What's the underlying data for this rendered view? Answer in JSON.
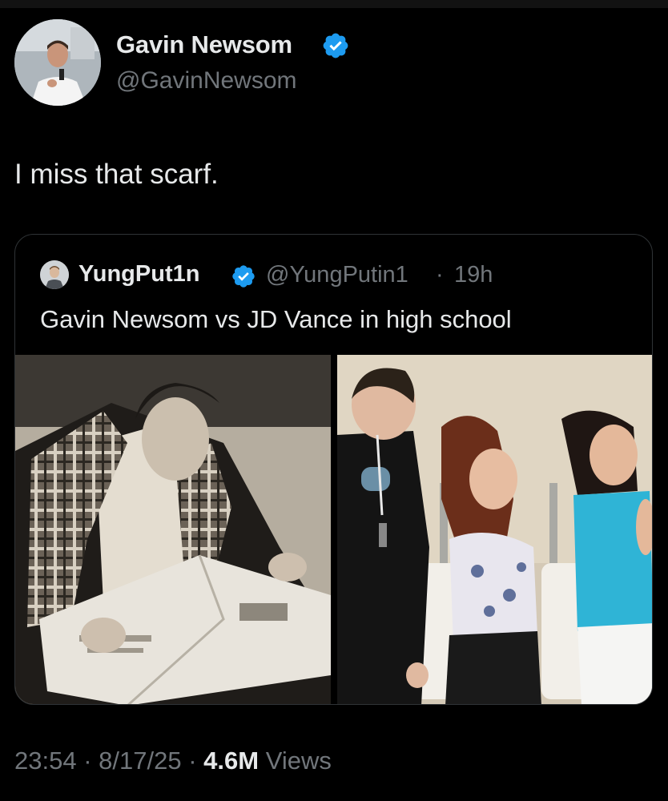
{
  "tweet": {
    "author": {
      "name": "Gavin Newsom",
      "handle": "@GavinNewsom",
      "verified_color": "#1d9bf0"
    },
    "text": "I miss that scarf.",
    "timestamp": {
      "time": "23:54",
      "separator1": "·",
      "date": "8/17/25",
      "separator2": "·",
      "views_count": "4.6M",
      "views_label": "Views"
    }
  },
  "quoted_tweet": {
    "author": {
      "name": "YungPut1n",
      "handle": "@YungPutin1",
      "separator": "·",
      "time_ago": "19h"
    },
    "text": "Gavin Newsom vs JD Vance in high school",
    "media": [
      {
        "description_icon": "photo-left"
      },
      {
        "description_icon": "photo-right"
      }
    ]
  }
}
